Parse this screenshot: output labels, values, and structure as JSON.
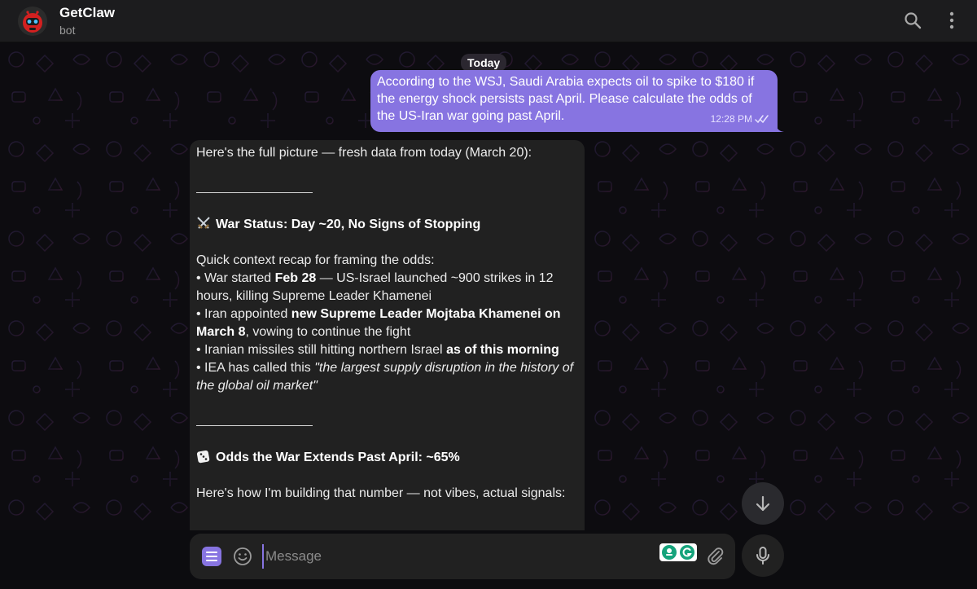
{
  "header": {
    "title": "GetClaw",
    "subtitle": "bot"
  },
  "chat": {
    "date_label": "Today",
    "outgoing": {
      "text": "According to the WSJ, Saudi Arabia expects oil to spike to $180 if the energy shock persists past April. Please calculate the odds of the US-Iran war going past April.",
      "time": "12:28 PM"
    },
    "incoming": {
      "intro": "Here's the full picture — fresh data from today (March 20):",
      "war_status": "War Status: Day ~20, No Signs of Stopping",
      "recap_heading": "Quick context recap for framing the odds:",
      "b1_pre": "• War started ",
      "b1_bold": "Feb 28",
      "b1_post": " — US-Israel launched ~900 strikes in 12 hours, killing Supreme Leader Khamenei",
      "b2_pre": "• Iran appointed ",
      "b2_bold": "new Supreme Leader Mojtaba Khamenei on March 8",
      "b2_post": ", vowing to continue the fight",
      "b3_pre": "• Iranian missiles still hitting northern Israel ",
      "b3_bold": "as of this morning",
      "b4_pre": "• IEA has called this ",
      "b4_italic": "\"the largest supply disruption in the history of the global oil market\"",
      "odds_heading": "Odds the War Extends Past April: ~65%",
      "method": "Here's how I'm building that number — not vibes, actual signals:"
    }
  },
  "composer": {
    "placeholder": "Message"
  },
  "icons": {
    "search": "search-icon",
    "more": "more-vertical-icon",
    "scroll": "arrow-down-icon",
    "menu": "menu-icon",
    "emoji": "smile-icon",
    "attach": "paperclip-icon",
    "mic": "microphone-icon"
  },
  "colors": {
    "accent": "#8774e1",
    "bubble_in": "#212121",
    "header": "#1c1c1e"
  }
}
